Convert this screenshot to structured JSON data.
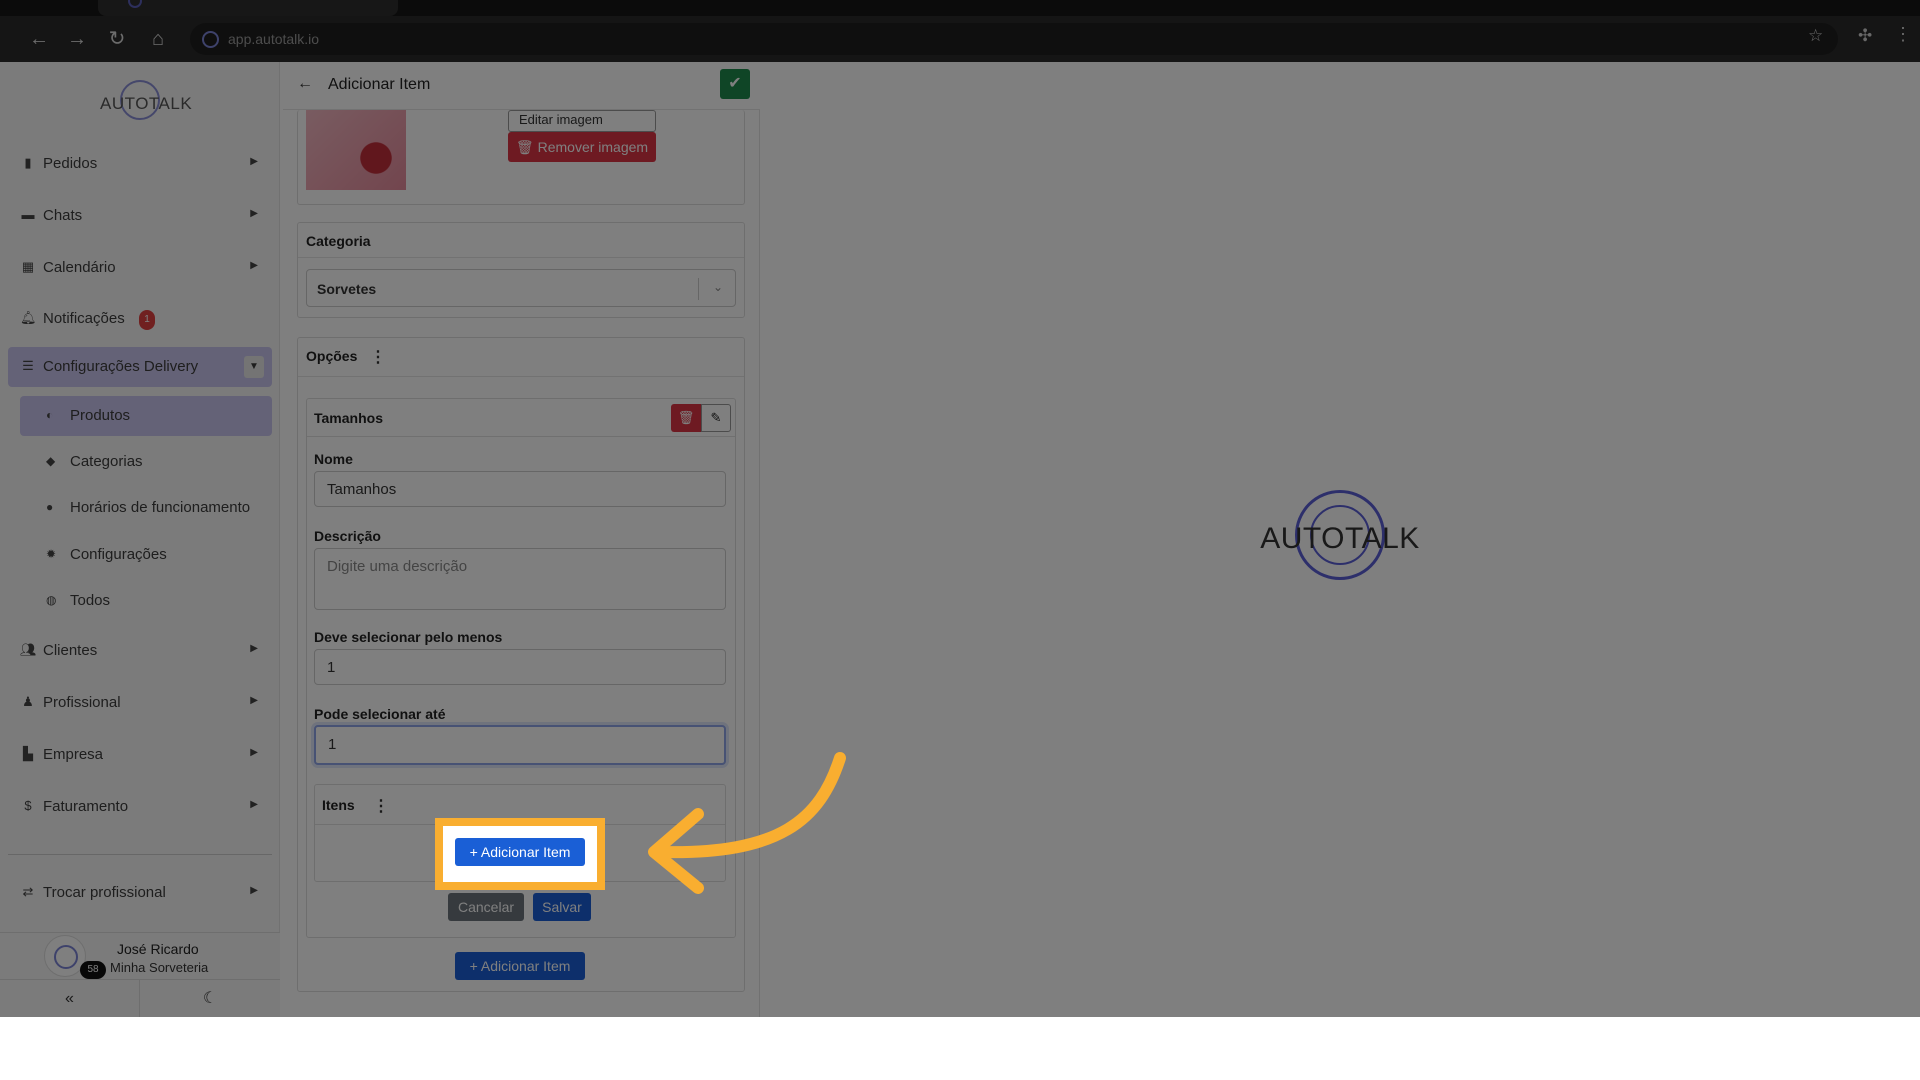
{
  "browser": {
    "url": "app.autotalk.io"
  },
  "brand": {
    "logo_text": "AUTOTALK",
    "accent": "#5b5fd6"
  },
  "sidebar": {
    "items": [
      {
        "label": "Pedidos",
        "icon": "clipboard-icon"
      },
      {
        "label": "Chats",
        "icon": "chat-icon"
      },
      {
        "label": "Calendário",
        "icon": "calendar-icon"
      },
      {
        "label": "Notificações",
        "icon": "bell-icon",
        "badge": "1"
      },
      {
        "label": "Configurações Delivery",
        "icon": "sliders-icon"
      }
    ],
    "sub_items": [
      {
        "label": "Produtos",
        "icon": "lock-icon"
      },
      {
        "label": "Categorias",
        "icon": "tag-icon"
      },
      {
        "label": "Horários de funcionamento",
        "icon": "clock-icon"
      },
      {
        "label": "Configurações",
        "icon": "gear-icon"
      },
      {
        "label": "Todos",
        "icon": "globe-icon"
      }
    ],
    "items_after": [
      {
        "label": "Clientes",
        "icon": "users-icon"
      },
      {
        "label": "Profissional",
        "icon": "user-tie-icon"
      },
      {
        "label": "Empresa",
        "icon": "building-icon"
      },
      {
        "label": "Faturamento",
        "icon": "dollar-icon"
      }
    ],
    "switch_label": "Trocar profissional",
    "user": {
      "name": "José Ricardo",
      "store": "Minha Sorveteria",
      "badge": "58"
    }
  },
  "panel": {
    "title": "Adicionar Item",
    "image": {
      "edit_label": "Editar imagem",
      "remove_label": "Remover imagem"
    },
    "category": {
      "title": "Categoria",
      "value": "Sorvetes"
    },
    "options": {
      "title": "Opções",
      "option_title": "Tamanhos",
      "name_label": "Nome",
      "name_value": "Tamanhos",
      "description_label": "Descrição",
      "description_placeholder": "Digite uma descrição",
      "min_label": "Deve selecionar pelo menos",
      "min_value": "1",
      "max_label": "Pode selecionar até",
      "max_value": "1",
      "items_title": "Itens",
      "add_item_label": "Adicionar Item",
      "cancel_label": "Cancelar",
      "save_label": "Salvar"
    },
    "add_item_bottom_label": "Adicionar Item"
  },
  "highlight": {
    "color": "#f9ae30"
  }
}
